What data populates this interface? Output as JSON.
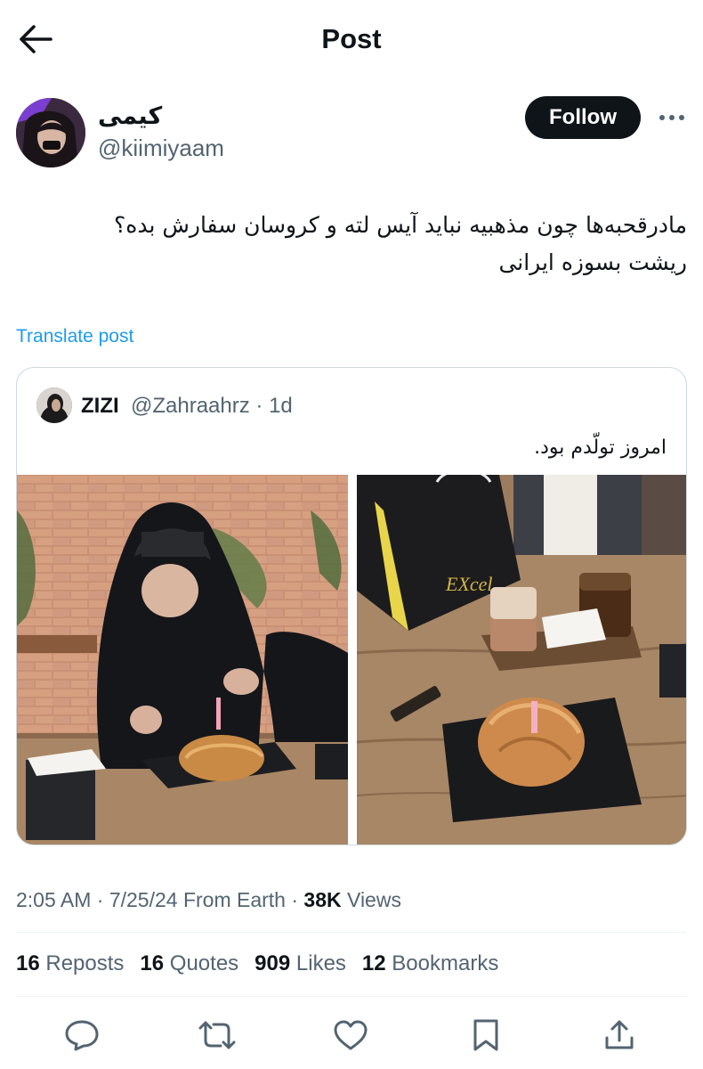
{
  "header": {
    "title": "Post",
    "back_icon": "arrow-left-icon"
  },
  "author": {
    "display_name": "کیمی",
    "handle": "@kiimiyaam",
    "follow_label": "Follow",
    "more_icon": "more-horizontal-icon"
  },
  "post": {
    "text_line1": "مادرقحبه‌ها چون مذهبیه نباید آیس لته و کروسان سفارش بده؟",
    "text_line2": "ریشت بسوزه ایرانی",
    "translate_label": "Translate post"
  },
  "quote": {
    "name": "ZIZI",
    "handle_time": "@Zahraahrz · 1d",
    "text": "امروز تولّدم بود.",
    "photos": [
      "photo-person-with-croissant",
      "photo-iced-coffees-and-croissant"
    ],
    "bag_label": "EXcel"
  },
  "meta": {
    "time_date": "2:05 AM · 7/25/24 From Earth · ",
    "views_count": "38K",
    "views_label": " Views"
  },
  "stats": [
    {
      "count": "16",
      "label": " Reposts"
    },
    {
      "count": "16",
      "label": " Quotes"
    },
    {
      "count": "909",
      "label": " Likes"
    },
    {
      "count": "12",
      "label": " Bookmarks"
    }
  ],
  "actions": [
    "reply-icon",
    "repost-icon",
    "like-icon",
    "bookmark-icon",
    "share-icon"
  ],
  "colors": {
    "accent": "#1d9bf0",
    "text": "#0f1419",
    "secondary": "#536471",
    "border": "#cfd9de"
  }
}
